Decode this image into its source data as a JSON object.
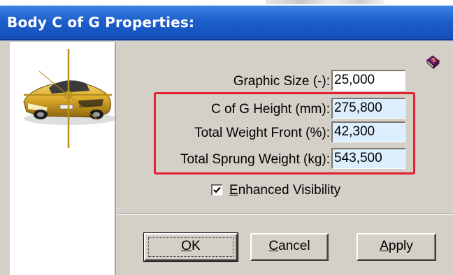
{
  "window": {
    "title": "Body C of G Properties:"
  },
  "icons": {
    "car": "car-cg-image-icon",
    "help": "help-book-icon",
    "check": "checkmark-icon"
  },
  "fields": [
    {
      "label": "Graphic Size (-):",
      "value": "25,000",
      "editable": true
    },
    {
      "label": "C of G Height (mm):",
      "value": "275,800",
      "editable": false
    },
    {
      "label": "Total Weight Front (%):",
      "value": "42,300",
      "editable": false
    },
    {
      "label": "Total Sprung Weight (kg):",
      "value": "543,500",
      "editable": false
    }
  ],
  "checkbox": {
    "label_prefix": "E",
    "label_rest": "nhanced Visibility",
    "checked": true
  },
  "buttons": {
    "ok": {
      "underlined": "O",
      "rest": "K"
    },
    "cancel": {
      "underlined": "C",
      "rest": "ancel"
    },
    "apply": {
      "underlined": "A",
      "rest": "pply"
    }
  },
  "colors": {
    "title_bar": "#1e5fcc",
    "dialog_face": "#d4d0c8",
    "highlight_border": "#e32131",
    "readonly_field": "#ddeeff"
  }
}
